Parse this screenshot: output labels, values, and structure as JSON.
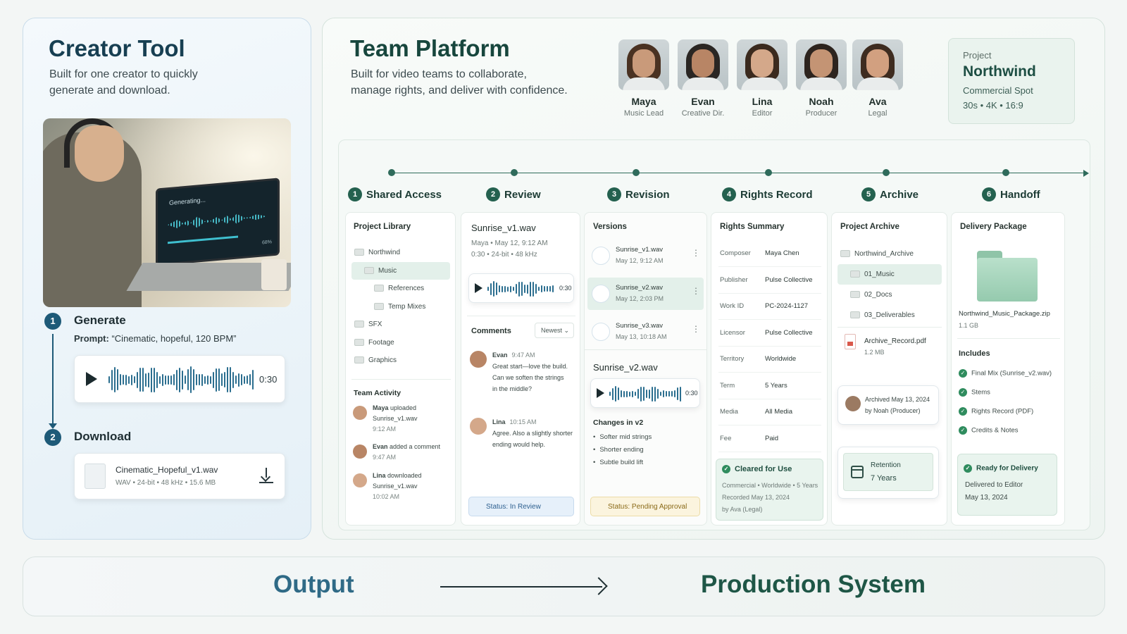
{
  "creator": {
    "title": "Creator Tool",
    "subtitle_line1": "Built for one creator to quickly",
    "subtitle_line2": "generate and download.",
    "screen_text": "Generating...",
    "screen_percent": "68%",
    "steps": [
      {
        "num": "1",
        "label": "Generate"
      },
      {
        "num": "2",
        "label": "Download"
      }
    ],
    "prompt_label": "Prompt:",
    "prompt_value": "“Cinematic, hopeful, 120 BPM”",
    "player_time": "0:30",
    "file_name": "Cinematic_Hopeful_v1.wav",
    "file_meta": "WAV  •  24-bit  •  48 kHz  •  15.6 MB"
  },
  "team": {
    "title": "Team Platform",
    "subtitle_line1": "Built for video teams to collaborate,",
    "subtitle_line2": "manage rights, and deliver with confidence.",
    "members": [
      {
        "name": "Maya",
        "role": "Music Lead"
      },
      {
        "name": "Evan",
        "role": "Creative Dir."
      },
      {
        "name": "Lina",
        "role": "Editor"
      },
      {
        "name": "Noah",
        "role": "Producer"
      },
      {
        "name": "Ava",
        "role": "Legal"
      }
    ],
    "project": {
      "label": "Project",
      "name": "Northwind",
      "type": "Commercial Spot",
      "specs": "30s  •  4K  •  16:9"
    },
    "stages": [
      {
        "num": "1",
        "label": "Shared Access"
      },
      {
        "num": "2",
        "label": "Review"
      },
      {
        "num": "3",
        "label": "Revision"
      },
      {
        "num": "4",
        "label": "Rights Record"
      },
      {
        "num": "5",
        "label": "Archive"
      },
      {
        "num": "6",
        "label": "Handoff"
      }
    ],
    "shared": {
      "library_title": "Project Library",
      "tree": [
        "Northwind",
        "Music",
        "References",
        "Temp Mixes",
        "SFX",
        "Footage",
        "Graphics"
      ],
      "activity_title": "Team Activity",
      "activity": [
        {
          "who": "Maya",
          "action": " uploaded",
          "obj": "Sunrise_v1.wav",
          "time": "9:12 AM"
        },
        {
          "who": "Evan",
          "action": " added a comment",
          "obj": "",
          "time": "9:47 AM"
        },
        {
          "who": "Lina",
          "action": " downloaded",
          "obj": "Sunrise_v1.wav",
          "time": "10:02 AM"
        }
      ]
    },
    "review": {
      "file": "Sunrise_v1.wav",
      "meta1": "Maya • May 12, 9:12 AM",
      "meta2": "0:30  •  24-bit  •  48 kHz",
      "time": "0:30",
      "comments_title": "Comments",
      "sort": "Newest",
      "comments": [
        {
          "who": "Evan",
          "time": "9:47 AM",
          "l1": "Great start—love the build.",
          "l2": "Can we soften the strings",
          "l3": "in the middle?"
        },
        {
          "who": "Lina",
          "time": "10:15 AM",
          "l1": "Agree. Also a slightly shorter",
          "l2": "ending would help.",
          "l3": ""
        }
      ],
      "status": "Status: In Review"
    },
    "revision": {
      "versions_title": "Versions",
      "versions": [
        {
          "file": "Sunrise_v1.wav",
          "date": "May 12, 9:12 AM"
        },
        {
          "file": "Sunrise_v2.wav",
          "date": "May 12, 2:03 PM"
        },
        {
          "file": "Sunrise_v3.wav",
          "date": "May 13, 10:18 AM"
        }
      ],
      "current": "Sunrise_v2.wav",
      "time": "0:30",
      "changes_title": "Changes in v2",
      "changes": [
        "Softer mid strings",
        "Shorter ending",
        "Subtle build lift"
      ],
      "status": "Status: Pending Approval"
    },
    "rights": {
      "title": "Rights Summary",
      "rows": [
        {
          "k": "Composer",
          "v": "Maya Chen"
        },
        {
          "k": "Publisher",
          "v": "Pulse Collective"
        },
        {
          "k": "Work ID",
          "v": "PC-2024-1127"
        },
        {
          "k": "Licensor",
          "v": "Pulse Collective"
        },
        {
          "k": "Territory",
          "v": "Worldwide"
        },
        {
          "k": "Term",
          "v": "5 Years"
        },
        {
          "k": "Media",
          "v": "All Media"
        },
        {
          "k": "Fee",
          "v": "Paid"
        }
      ],
      "cleared": "Cleared for Use",
      "cleared_l1": "Commercial • Worldwide • 5 Years",
      "cleared_l2": "Recorded May 13, 2024",
      "cleared_l3": "by Ava (Legal)"
    },
    "archive": {
      "title": "Project Archive",
      "tree": [
        "Northwind_Archive",
        "01_Music",
        "02_Docs",
        "03_Deliverables"
      ],
      "record_file": "Archive_Record.pdf",
      "record_size": "1.2 MB",
      "archived_l1": "Archived May 13, 2024",
      "archived_l2": "by Noah (Producer)",
      "retention_label": "Retention",
      "retention_value": "7 Years"
    },
    "handoff": {
      "title": "Delivery Package",
      "zip": "Northwind_Music_Package.zip",
      "zip_size": "1.1 GB",
      "includes_title": "Includes",
      "includes": [
        "Final Mix (Sunrise_v2.wav)",
        "Stems",
        "Rights Record (PDF)",
        "Credits & Notes"
      ],
      "ready": "Ready for Delivery",
      "ready_l1": "Delivered to Editor",
      "ready_l2": "May 13, 2024"
    }
  },
  "bottom": {
    "left": "Output",
    "right": "Production System"
  },
  "colors": {
    "creator_accent": "#1e5a78",
    "team_accent": "#24614f",
    "review_status": "#4a84c4",
    "pending_status": "#e0b84c",
    "cleared": "#2f8c5e"
  }
}
